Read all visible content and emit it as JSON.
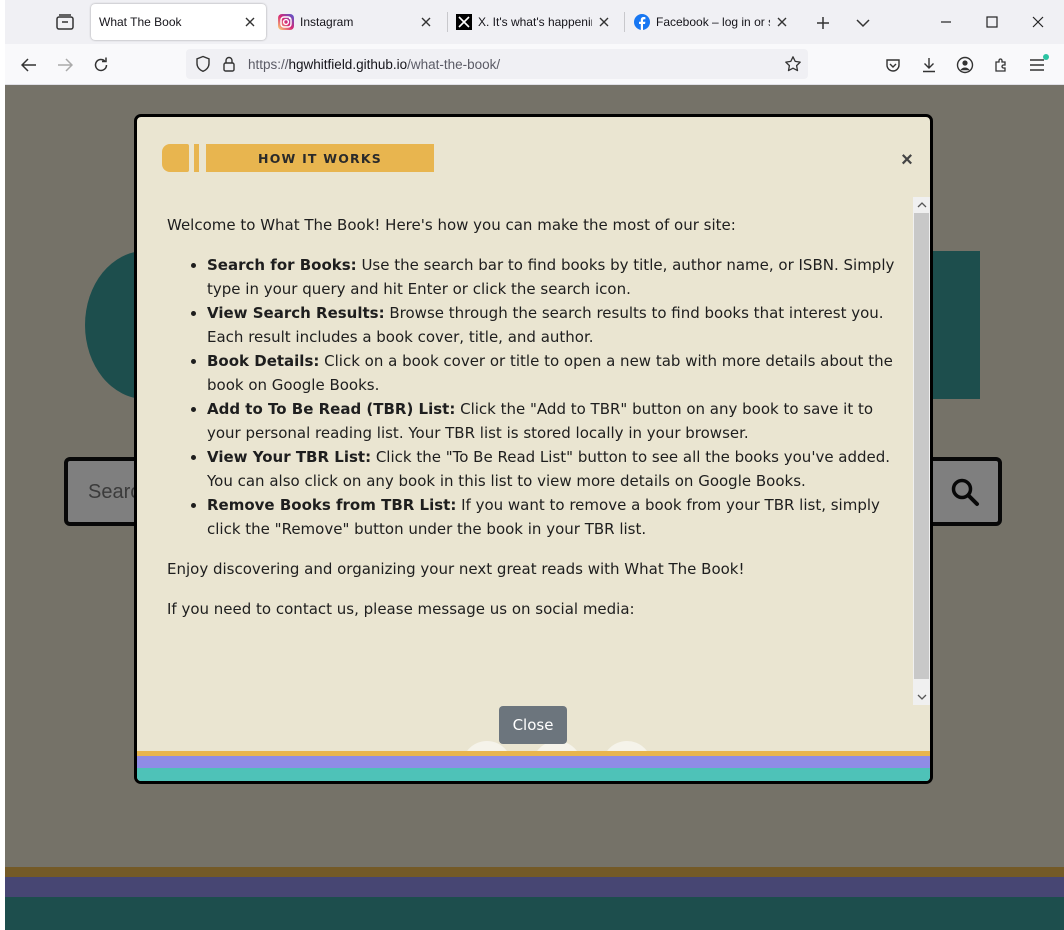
{
  "browser": {
    "tabs": [
      {
        "title": "What The Book",
        "favicon": "none",
        "active": true
      },
      {
        "title": "Instagram",
        "favicon": "instagram-icon",
        "active": false
      },
      {
        "title": "X. It's what's happening",
        "favicon": "x-icon",
        "active": false
      },
      {
        "title": "Facebook – log in or sign up",
        "favicon": "facebook-icon",
        "active": false
      }
    ],
    "url_prefix": "https://",
    "url_host": "hgwhitfield.github.io",
    "url_path": "/what-the-book/"
  },
  "page": {
    "search_placeholder": "Search for books..."
  },
  "modal": {
    "title": "HOW IT WORKS",
    "close_x": "×",
    "intro": "Welcome to What The Book! Here's how you can make the most of our site:",
    "items": [
      {
        "head": "Search for Books:",
        "text": " Use the search bar to find books by title, author name, or ISBN. Simply type in your query and hit Enter or click the search icon."
      },
      {
        "head": "View Search Results:",
        "text": " Browse through the search results to find books that interest you. Each result includes a book cover, title, and author."
      },
      {
        "head": "Book Details:",
        "text": " Click on a book cover or title to open a new tab with more details about the book on Google Books."
      },
      {
        "head": "Add to To Be Read (TBR) List:",
        "text": " Click the \"Add to TBR\" button on any book to save it to your personal reading list. Your TBR list is stored locally in your browser."
      },
      {
        "head": "View Your TBR List:",
        "text": " Click the \"To Be Read List\" button to see all the books you've added. You can also click on any book in this list to view more details on Google Books."
      },
      {
        "head": "Remove Books from TBR List:",
        "text": " If you want to remove a book from your TBR list, simply click the \"Remove\" button under the book in your TBR list."
      }
    ],
    "outro": "Enjoy discovering and organizing your next great reads with What The Book!",
    "contact": "If you need to contact us, please message us on social media:",
    "social": [
      "facebook-icon",
      "twitter-icon",
      "instagram-icon"
    ],
    "close_label": "Close"
  },
  "colors": {
    "accent_yellow": "#e8b54f",
    "teal": "#3b9c9b",
    "purple": "#8f8ce6",
    "teal_light": "#4ec2b8",
    "modal_bg": "#eae5d1",
    "close_btn": "#6c757d"
  }
}
